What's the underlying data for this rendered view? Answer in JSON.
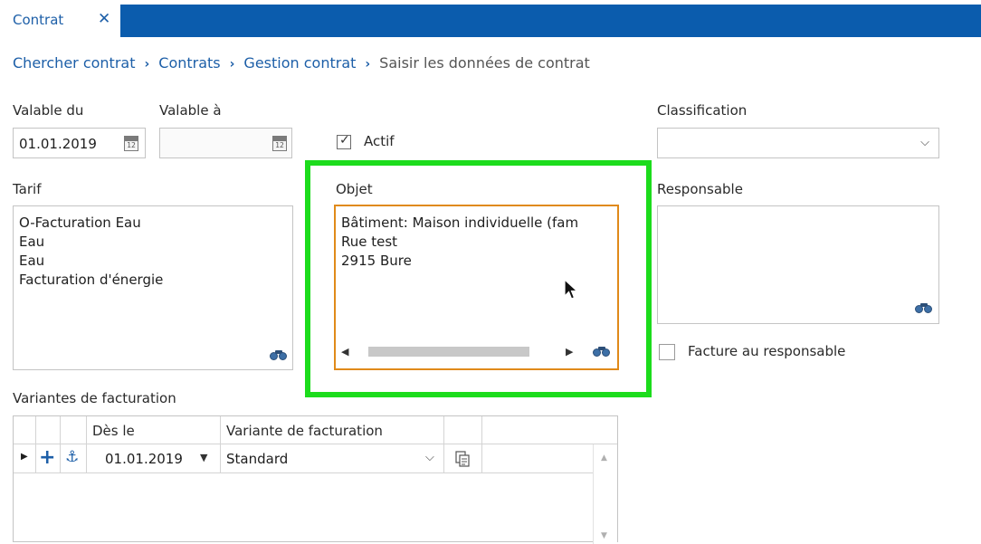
{
  "tab": {
    "title": "Contrat",
    "close_glyph": "✕"
  },
  "breadcrumb": {
    "items": [
      "Chercher contrat",
      "Contrats",
      "Gestion contrat"
    ],
    "current": "Saisir les données de contrat",
    "separator": "›"
  },
  "form": {
    "valable_du": {
      "label": "Valable du",
      "value": "01.01.2019"
    },
    "valable_a": {
      "label": "Valable à",
      "value": ""
    },
    "actif": {
      "label": "Actif",
      "checked": true
    },
    "classification": {
      "label": "Classification",
      "value": ""
    },
    "tarif": {
      "label": "Tarif",
      "lines": [
        "O-Facturation Eau",
        "Eau",
        "Eau",
        "Facturation d'énergie"
      ]
    },
    "objet": {
      "label": "Objet",
      "lines": [
        "Bâtiment: Maison individuelle (fam",
        "Rue test",
        "2915 Bure"
      ]
    },
    "responsable": {
      "label": "Responsable",
      "lines": []
    },
    "facture_au_responsable": {
      "label": "Facture au responsable",
      "checked": false
    }
  },
  "grid": {
    "title": "Variantes de facturation",
    "columns": [
      "Dès le",
      "Variante de facturation"
    ],
    "rows": [
      {
        "des_le": "01.01.2019",
        "variante": "Standard"
      }
    ]
  },
  "icons": {
    "calendar": "calendar-icon",
    "binoculars": "binoculars-icon",
    "add": "plus-icon",
    "anchor": "anchor-icon",
    "copy": "copy-icon"
  },
  "colors": {
    "accent_blue": "#0b5cad",
    "link_blue": "#1d5fa8",
    "highlight_green": "#1cdc1c",
    "focus_orange": "#e08a1a"
  }
}
